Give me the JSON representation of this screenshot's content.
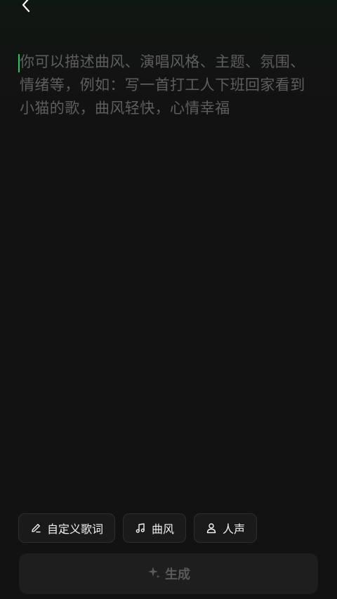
{
  "navigation": {
    "back_icon": "chevron-left-icon"
  },
  "prompt": {
    "placeholder": "你可以描述曲风、演唱风格、主题、氛围、情绪等，例如：写一首打工人下班回家看到小猫的歌，曲风轻快，心情幸福",
    "value": "",
    "caret_color": "#22c55e"
  },
  "chips": [
    {
      "icon": "pencil-icon",
      "label": "自定义歌词"
    },
    {
      "icon": "music-note-icon",
      "label": "曲风"
    },
    {
      "icon": "person-icon",
      "label": "人声"
    }
  ],
  "generate": {
    "icon": "sparkle-icon",
    "label": "生成",
    "enabled": false
  },
  "colors": {
    "background": "#121212",
    "accent": "#22c55e",
    "placeholder_text": "#5e5e5e",
    "chip_background": "#1a1a1a",
    "chip_border": "#2e2e2e",
    "generate_background": "#1e1e1e",
    "generate_text_disabled": "#5a5a5a"
  }
}
